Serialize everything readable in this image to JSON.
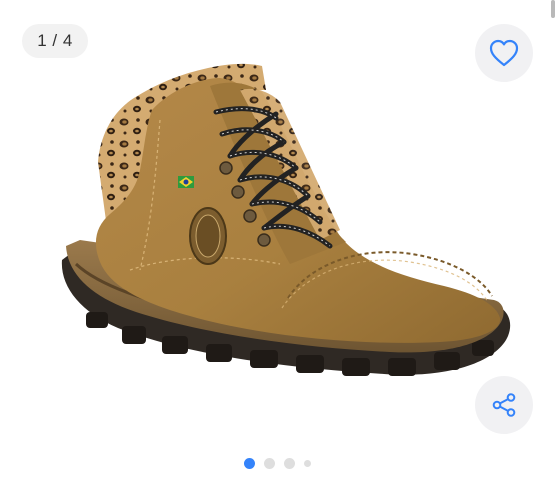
{
  "gallery": {
    "counter_text": "1 / 4",
    "current_index": 1,
    "total_images": 4,
    "image_alt": "",
    "favorite_icon": "heart-outline-icon",
    "share_icon": "share-icon",
    "accent_color": "#3483fa",
    "button_background": "#f1f1f3"
  }
}
